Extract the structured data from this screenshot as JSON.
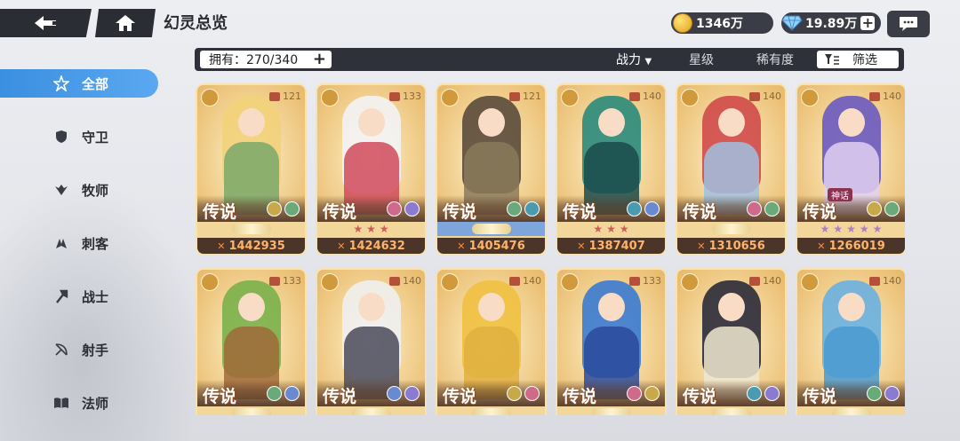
{
  "header": {
    "title": "幻灵总览",
    "gold": "1346万",
    "gems": "19.89万",
    "gold_icon": "coin-icon",
    "gem_icon": "diamond-icon"
  },
  "sidebar": {
    "items": [
      {
        "label": "全部",
        "icon": "all-star-icon",
        "active": true
      },
      {
        "label": "守卫",
        "icon": "shield-icon"
      },
      {
        "label": "牧师",
        "icon": "wings-icon"
      },
      {
        "label": "刺客",
        "icon": "claw-icon"
      },
      {
        "label": "战士",
        "icon": "axe-icon"
      },
      {
        "label": "射手",
        "icon": "bow-icon"
      },
      {
        "label": "法师",
        "icon": "book-icon"
      }
    ]
  },
  "filterbar": {
    "owned": "拥有：270/340",
    "sort_power": "战力",
    "sort_star": "星级",
    "sort_rarity": "稀有度",
    "filter": "筛选"
  },
  "cards": [
    {
      "rarity": "传说",
      "level": "121",
      "power": "1442935",
      "stars": 0,
      "class": "priest",
      "hair": "#f2d27a",
      "body": "#7aa86a",
      "elems": [
        "#c9a84a",
        "#6aaa7a"
      ]
    },
    {
      "rarity": "传说",
      "level": "133",
      "power": "1424632",
      "stars": 3,
      "class": "mage",
      "hair": "#f3f3f5",
      "body": "#d04a5a",
      "elems": [
        "#d06a8a",
        "#8a7ad0"
      ]
    },
    {
      "rarity": "传说",
      "level": "121",
      "power": "1405476",
      "stars": 0,
      "class": "warrior",
      "hair": "#5a4a3a",
      "body": "#8a7a5a",
      "elems": [
        "#6aaa7a",
        "#4a9ab0"
      ],
      "blue": true
    },
    {
      "rarity": "传说",
      "level": "140",
      "power": "1387407",
      "stars": 3,
      "class": "warrior",
      "hair": "#2a8a7a",
      "body": "#1a4a4a",
      "elems": [
        "#4a9ab0",
        "#6a8ad0"
      ]
    },
    {
      "rarity": "传说",
      "level": "140",
      "power": "1310656",
      "stars": 0,
      "class": "warrior",
      "hair": "#d04a4a",
      "body": "#a0c0e0",
      "elems": [
        "#d06a8a",
        "#6aaa7a"
      ]
    },
    {
      "rarity": "传说",
      "level": "140",
      "power": "1266019",
      "stars": 5,
      "class": "guard",
      "hair": "#6a5ac0",
      "body": "#e0d0f0",
      "elems": [
        "#c9a84a",
        "#6aaa7a"
      ],
      "mythic": "神话"
    },
    {
      "rarity": "传说",
      "level": "133",
      "power": "",
      "stars": 0,
      "class": "mage",
      "hair": "#7ab04a",
      "body": "#a06a3a",
      "elems": [
        "#6aaa7a",
        "#6a8ad0"
      ]
    },
    {
      "rarity": "传说",
      "level": "140",
      "power": "",
      "stars": 0,
      "class": "guard",
      "hair": "#f0f0f0",
      "body": "#4a4a5a",
      "elems": [
        "#6a8ad0",
        "#8a7ad0"
      ]
    },
    {
      "rarity": "传说",
      "level": "140",
      "power": "",
      "stars": 0,
      "class": "archer",
      "hair": "#f0c040",
      "body": "#e0b040",
      "elems": [
        "#c9a84a",
        "#d06a8a"
      ]
    },
    {
      "rarity": "传说",
      "level": "133",
      "power": "",
      "stars": 0,
      "class": "mage",
      "hair": "#3a7ad0",
      "body": "#2a4a9a",
      "elems": [
        "#d06a8a",
        "#c9a84a"
      ]
    },
    {
      "rarity": "传说",
      "level": "140",
      "power": "",
      "stars": 0,
      "class": "mage",
      "hair": "#2a2a3a",
      "body": "#f0e8d0",
      "elems": [
        "#4a9ab0",
        "#8a7ad0"
      ]
    },
    {
      "rarity": "传说",
      "level": "140",
      "power": "",
      "stars": 0,
      "class": "guard",
      "hair": "#6ab0e0",
      "body": "#4a9ad0",
      "elems": [
        "#6aaa7a",
        "#8a7ad0"
      ]
    }
  ]
}
